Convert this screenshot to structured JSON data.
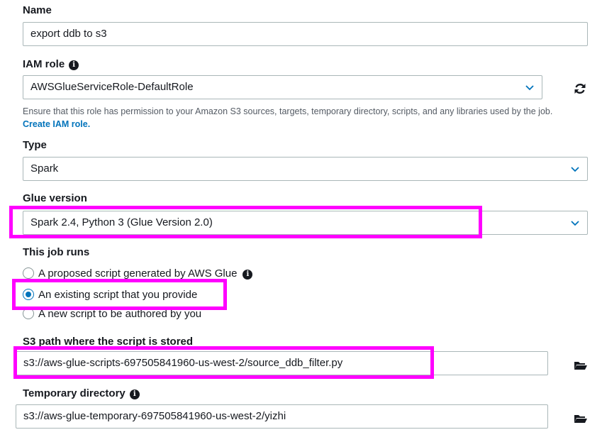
{
  "name_field": {
    "label": "Name",
    "value": "export ddb to s3"
  },
  "iam_role": {
    "label": "IAM role",
    "value": "AWSGlueServiceRole-DefaultRole",
    "help": "Ensure that this role has permission to your Amazon S3 sources, targets, temporary directory, scripts, and any libraries used by the job.",
    "create_link": "Create IAM role."
  },
  "type_field": {
    "label": "Type",
    "value": "Spark"
  },
  "glue_version": {
    "label": "Glue version",
    "value": "Spark 2.4, Python 3 (Glue Version 2.0)"
  },
  "job_runs": {
    "label": "This job runs",
    "options": [
      {
        "label": "A proposed script generated by AWS Glue",
        "checked": false
      },
      {
        "label": "An existing script that you provide",
        "checked": true
      },
      {
        "label": "A new script to be authored by you",
        "checked": false
      }
    ]
  },
  "s3_path": {
    "label": "S3 path where the script is stored",
    "value": "s3://aws-glue-scripts-697505841960-us-west-2/source_ddb_filter.py"
  },
  "temp_dir": {
    "label": "Temporary directory",
    "value": "s3://aws-glue-temporary-697505841960-us-west-2/yizhi"
  },
  "colors": {
    "highlight": "#ff00ff",
    "link": "#0073bb",
    "radio_checked": "#0073bb"
  },
  "icons": {
    "info": "info-icon",
    "refresh": "refresh-icon",
    "folder": "folder-icon",
    "chevron": "chevron-down-icon"
  }
}
